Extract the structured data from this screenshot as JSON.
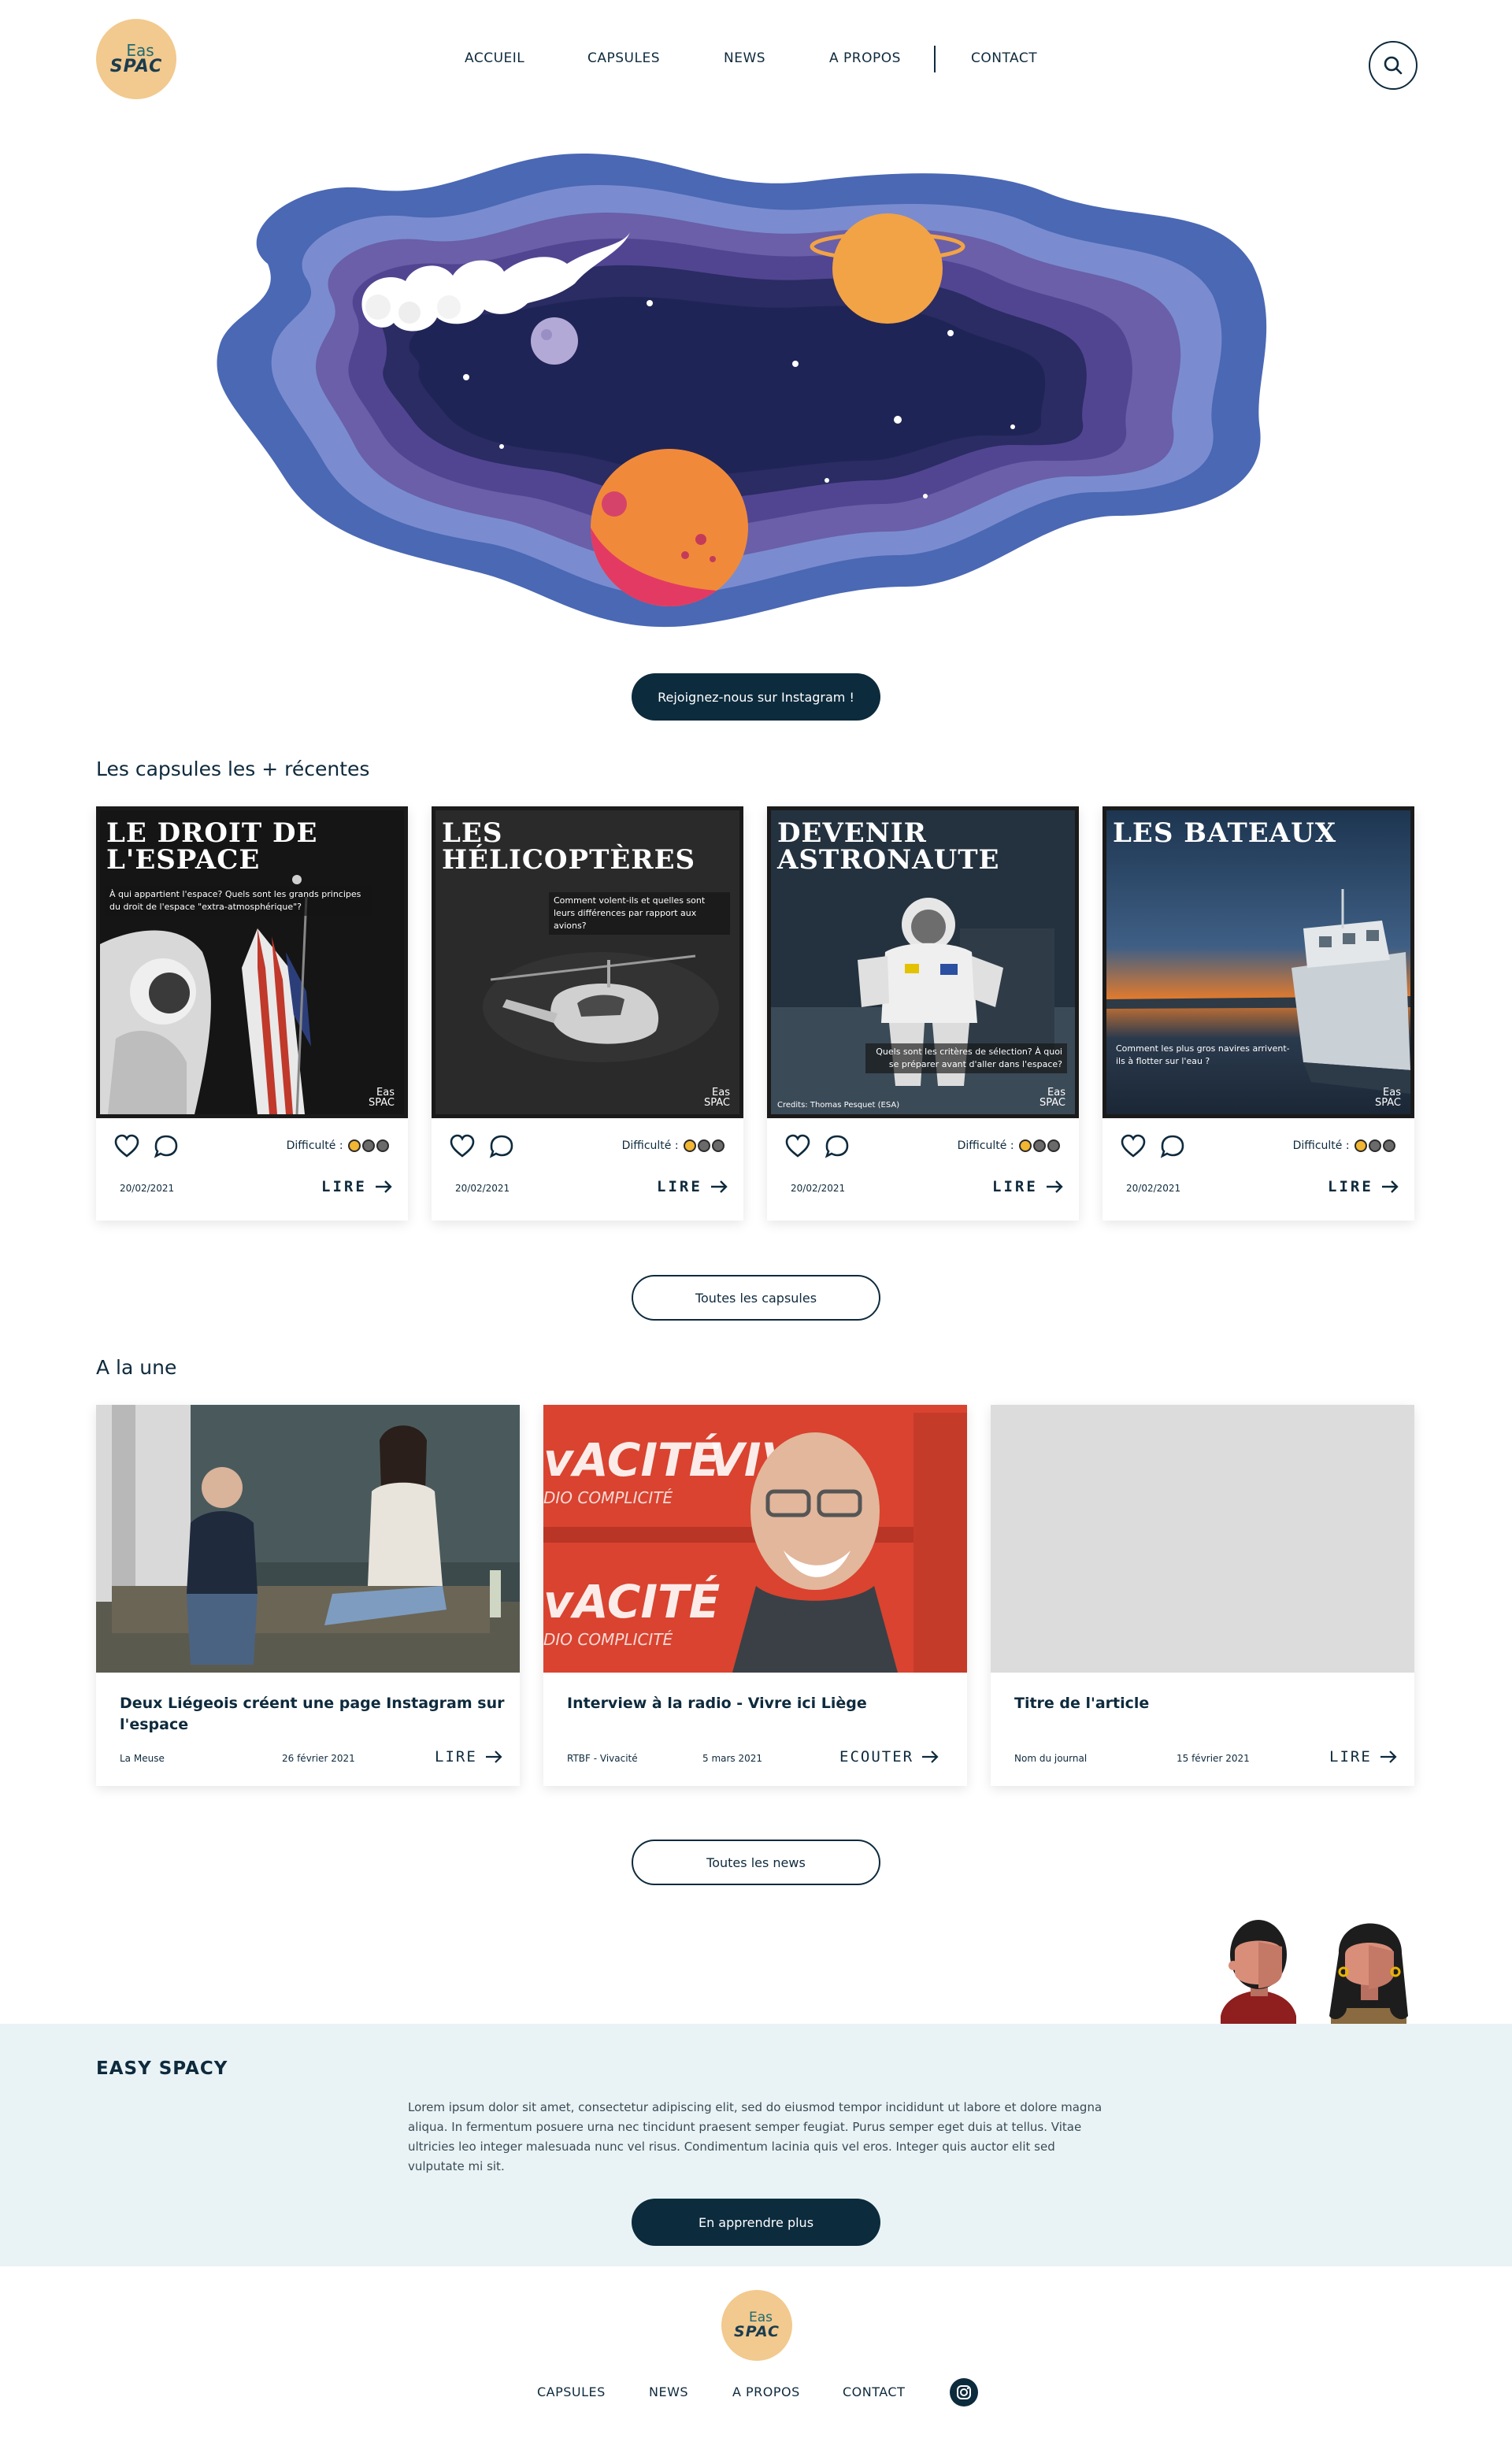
{
  "header": {
    "logo_line1": "Eas",
    "logo_line2": "SPAC",
    "nav": [
      "ACCUEIL",
      "CAPSULES",
      "NEWS",
      "A PROPOS",
      "CONTACT"
    ]
  },
  "hero": {
    "instagram_button": "Rejoignez-nous sur Instagram !"
  },
  "capsules": {
    "section_title": "Les capsules les + récentes",
    "difficulty_label": "Difficulté :",
    "read_label": "LIRE",
    "items": [
      {
        "title": "LE DROIT DE L'ESPACE",
        "description": "À qui appartient l'espace? Quels sont les grands principes du droit de l'espace \"extra-atmosphérique\"?",
        "credit": "",
        "date": "20/02/2021",
        "difficulty": 1
      },
      {
        "title": "LES HÉLICOPTÈRES",
        "description": "Comment volent-ils et quelles sont leurs différences par rapport aux avions?",
        "credit": "",
        "date": "20/02/2021",
        "difficulty": 1
      },
      {
        "title": "DEVENIR ASTRONAUTE",
        "description": "Quels sont les critères de sélection? À quoi se préparer avant d'aller dans l'espace?",
        "credit": "Credits: Thomas Pesquet (ESA)",
        "date": "20/02/2021",
        "difficulty": 1
      },
      {
        "title": "LES BATEAUX",
        "description": "Comment les plus gros navires arrivent-ils à flotter sur l'eau ?",
        "credit": "",
        "date": "20/02/2021",
        "difficulty": 1
      }
    ],
    "all_button": "Toutes les capsules"
  },
  "news": {
    "section_title": "A la une",
    "items": [
      {
        "title": "Deux Liégeois créent une page Instagram sur l'espace",
        "source": "La Meuse",
        "date": "26 février 2021",
        "action": "LIRE"
      },
      {
        "title": "Interview à la radio - Vivre ici Liège",
        "source": "RTBF - Vivacité",
        "date": "5 mars 2021",
        "action": "ECOUTER"
      },
      {
        "title": "Titre de l'article",
        "source": "Nom du journal",
        "date": "15 février 2021",
        "action": "LIRE"
      }
    ],
    "radio_sign_1": "vACITÉ",
    "radio_sign_2": "VIV",
    "radio_sub": "DIO COMPLICITÉ",
    "all_button": "Toutes les news"
  },
  "about": {
    "title": "EASY SPACY",
    "text": "Lorem ipsum dolor sit amet, consectetur adipiscing elit, sed do eiusmod tempor incididunt ut labore et dolore magna aliqua. In fermentum posuere urna nec tincidunt praesent semper feugiat. Purus semper eget duis at tellus. Vitae ultricies leo integer malesuada nunc vel risus. Condimentum lacinia quis vel eros. Integer quis auctor elit sed vulputate mi sit.",
    "button": "En apprendre plus"
  },
  "footer": {
    "nav": [
      "CAPSULES",
      "NEWS",
      "A PROPOS",
      "CONTACT"
    ]
  },
  "colors": {
    "navy": "#0c2b3d",
    "logo_bg": "#f2c98e",
    "about_bg": "#e9f3f5",
    "difficulty_on": "#f2b632"
  },
  "icons": [
    "search-icon",
    "heart-icon",
    "comment-icon",
    "arrow-right-icon",
    "instagram-icon"
  ]
}
